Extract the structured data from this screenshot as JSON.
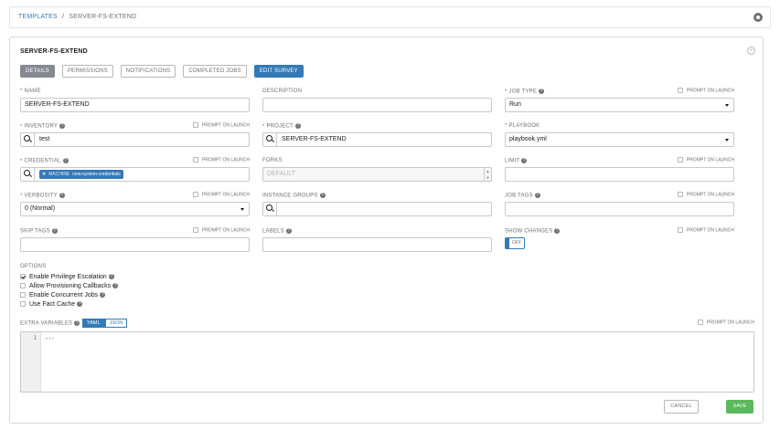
{
  "breadcrumb": {
    "parent": "TEMPLATES",
    "separator": "/",
    "current": "SERVER-FS-EXTEND"
  },
  "panel": {
    "title": "SERVER-FS-EXTEND"
  },
  "tabs": {
    "details": "DETAILS",
    "permissions": "PERMISSIONS",
    "notifications": "NOTIFICATIONS",
    "completed_jobs": "COMPLETED JOBS",
    "edit_survey": "EDIT SURVEY"
  },
  "prompt_on_launch": "PROMPT ON LAUNCH",
  "fields": {
    "name": {
      "label": "NAME",
      "value": "SERVER-FS-EXTEND"
    },
    "description": {
      "label": "DESCRIPTION",
      "value": ""
    },
    "job_type": {
      "label": "JOB TYPE",
      "value": "Run"
    },
    "inventory": {
      "label": "INVENTORY",
      "value": "test"
    },
    "project": {
      "label": "PROJECT",
      "value": "SERVER-FS-EXTEND"
    },
    "playbook": {
      "label": "PLAYBOOK",
      "value": "playbook.yml"
    },
    "credential": {
      "label": "CREDENTIAL",
      "tag_close": "✕",
      "tag_type": "MACHINE",
      "tag_name": "new-system-credentials"
    },
    "forks": {
      "label": "FORKS",
      "placeholder": "DEFAULT"
    },
    "limit": {
      "label": "LIMIT",
      "value": ""
    },
    "verbosity": {
      "label": "VERBOSITY",
      "value": "0 (Normal)"
    },
    "instance_groups": {
      "label": "INSTANCE GROUPS",
      "value": ""
    },
    "job_tags": {
      "label": "JOB TAGS",
      "value": ""
    },
    "skip_tags": {
      "label": "SKIP TAGS",
      "value": ""
    },
    "labels": {
      "label": "LABELS",
      "value": ""
    },
    "show_changes": {
      "label": "SHOW CHANGES",
      "state": "OFF"
    }
  },
  "options": {
    "title": "OPTIONS",
    "items": [
      {
        "label": "Enable Privilege Escalation",
        "checked": true
      },
      {
        "label": "Allow Provisioning Callbacks",
        "checked": false
      },
      {
        "label": "Enable Concurrent Jobs",
        "checked": false
      },
      {
        "label": "Use Fact Cache",
        "checked": false
      }
    ]
  },
  "extra_variables": {
    "label": "EXTRA VARIABLES",
    "yaml": "YAML",
    "json": "JSON",
    "line_number": "1",
    "content": "---"
  },
  "buttons": {
    "cancel": "CANCEL",
    "save": "SAVE"
  },
  "icons": {
    "settings": "gear-icon",
    "close": "close-icon",
    "search": "search-icon",
    "help": "help-icon"
  },
  "colors": {
    "primary": "#337ab7",
    "success": "#5cb85c",
    "required": "#d9534f",
    "active_tab": "#848992"
  }
}
